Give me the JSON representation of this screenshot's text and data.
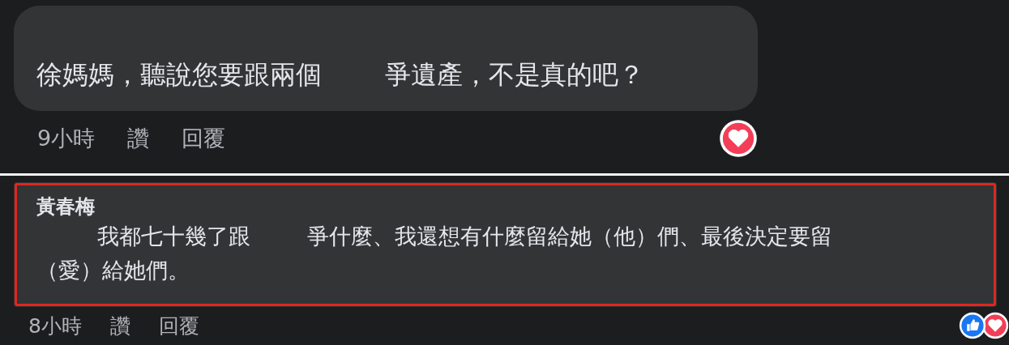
{
  "comments": [
    {
      "highlighted": false,
      "lines": [
        [
          "徐媽媽，聽說您要跟兩個",
          "爭遺產，不是真的吧？"
        ]
      ],
      "time": "9小時",
      "actions": [
        "讚",
        "回覆"
      ],
      "reactions": [
        {
          "kind": "heart"
        }
      ]
    },
    {
      "highlighted": true,
      "author": "黃春梅",
      "lines": [
        [
          "我都七十幾了跟",
          "爭什麼、我還想有什麼留給她（他）們、最後決定要留"
        ],
        [
          "（愛）給她們。"
        ]
      ],
      "time": "8小時",
      "actions": [
        "讚",
        "回覆"
      ],
      "reactions": [
        {
          "kind": "like"
        },
        {
          "kind": "heart"
        }
      ]
    }
  ]
}
